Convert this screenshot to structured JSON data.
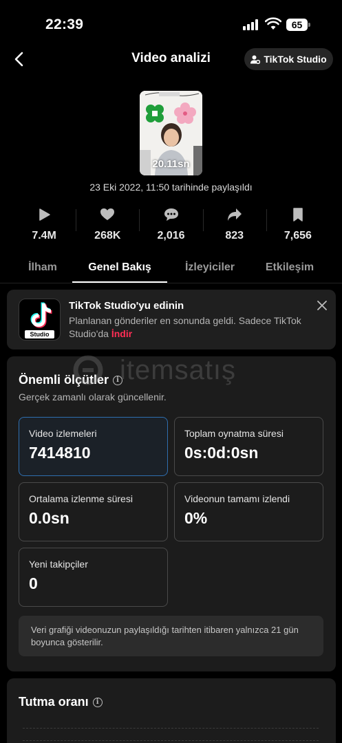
{
  "status_bar": {
    "time": "22:39",
    "battery": "65"
  },
  "header": {
    "title": "Video analizi",
    "studio_button": "TikTok Studio"
  },
  "video": {
    "duration": "20.11sn",
    "shared_date": "23 Eki 2022, 11:50 tarihinde paylaşıldı"
  },
  "stats": [
    {
      "icon": "play-icon",
      "value": "7.4M"
    },
    {
      "icon": "heart-icon",
      "value": "268K"
    },
    {
      "icon": "comment-icon",
      "value": "2,016"
    },
    {
      "icon": "share-icon",
      "value": "823"
    },
    {
      "icon": "bookmark-icon",
      "value": "7,656"
    }
  ],
  "tabs": [
    {
      "label": "İlham",
      "active": false
    },
    {
      "label": "Genel Bakış",
      "active": true
    },
    {
      "label": "İzleyiciler",
      "active": false
    },
    {
      "label": "Etkileşim",
      "active": false
    }
  ],
  "promo": {
    "logo_label": "Studio",
    "title": "TikTok Studio'yu edinin",
    "body": "Planlanan gönderiler en sonunda geldi. Sadece TikTok Studio'da",
    "link": "İndir"
  },
  "metrics": {
    "title": "Önemli ölçütler",
    "subtitle": "Gerçek zamanlı olarak güncellenir.",
    "items": [
      {
        "label": "Video izlemeleri",
        "value": "7414810"
      },
      {
        "label": "Toplam oynatma süresi",
        "value": "0s:0d:0sn"
      },
      {
        "label": "Ortalama izlenme süresi",
        "value": "0.0sn"
      },
      {
        "label": "Videonun tamamı izlendi",
        "value": "0%"
      },
      {
        "label": "Yeni takipçiler",
        "value": "0"
      }
    ],
    "note": "Veri grafiği videonuzun paylaşıldığı tarihten itibaren yalnızca 21 gün boyunca gösterilir."
  },
  "retention": {
    "title": "Tutma oranı"
  },
  "watermark": {
    "text": "itemsatış"
  },
  "colors": {
    "accent_link": "#ff2e55",
    "highlight_border": "#2f6fb0",
    "background": "#000000",
    "card": "#1c1c1c"
  }
}
